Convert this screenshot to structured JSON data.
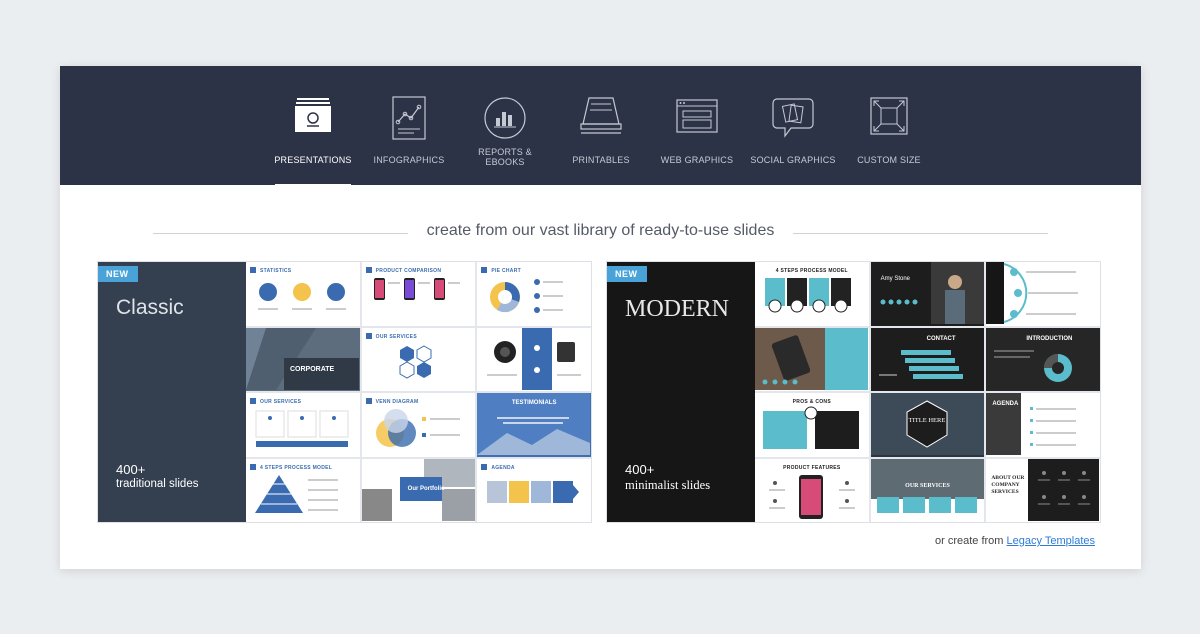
{
  "nav": {
    "tabs": [
      {
        "label": "PRESENTATIONS",
        "icon": "presentation-icon",
        "active": true
      },
      {
        "label": "INFOGRAPHICS",
        "icon": "infographic-icon"
      },
      {
        "label": "REPORTS &\nEBOOKS",
        "icon": "report-chart-icon"
      },
      {
        "label": "PRINTABLES",
        "icon": "printer-icon"
      },
      {
        "label": "WEB GRAPHICS",
        "icon": "browser-window-icon"
      },
      {
        "label": "SOCIAL GRAPHICS",
        "icon": "speech-bubble-icon"
      },
      {
        "label": "CUSTOM SIZE",
        "icon": "expand-arrows-icon"
      }
    ]
  },
  "headline": "create from our vast library of ready-to-use slides",
  "templates": {
    "classic": {
      "badge": "NEW",
      "name": "Classic",
      "count": "400+",
      "subtitle": "traditional slides",
      "thumbs": [
        "STATISTICS",
        "PRODUCT COMPARISON",
        "PIE CHART",
        "CORPORATE",
        "OUR SERVICES",
        "",
        "OUR SERVICES",
        "VENN DIAGRAM",
        "TESTIMONIALS",
        "4 STEPS PROCESS MODEL",
        "Our Portfolio",
        "AGENDA"
      ]
    },
    "modern": {
      "badge": "NEW",
      "name": "MODERN",
      "count": "400+",
      "subtitle": "minimalist slides",
      "thumbs": [
        "4 STEPS PROCESS MODEL",
        "Amy Stone",
        "",
        "",
        "CONTACT",
        "INTRODUCTION",
        "PROS & CONS",
        "TITLE HERE",
        "AGENDA",
        "PRODUCT FEATURES",
        "OUR SERVICES",
        "ABOUT OUR COMPANY SERVICES"
      ]
    }
  },
  "footer": {
    "prefix": "or create from ",
    "link": "Legacy Templates"
  },
  "colors": {
    "nav_bg": "#2d3347",
    "badge": "#4aa3d8",
    "classic_side": "#34404f",
    "modern_side": "#161616",
    "accent_blue": "#3a6bb0",
    "accent_teal": "#5bbccb",
    "link": "#2e7cd6"
  }
}
